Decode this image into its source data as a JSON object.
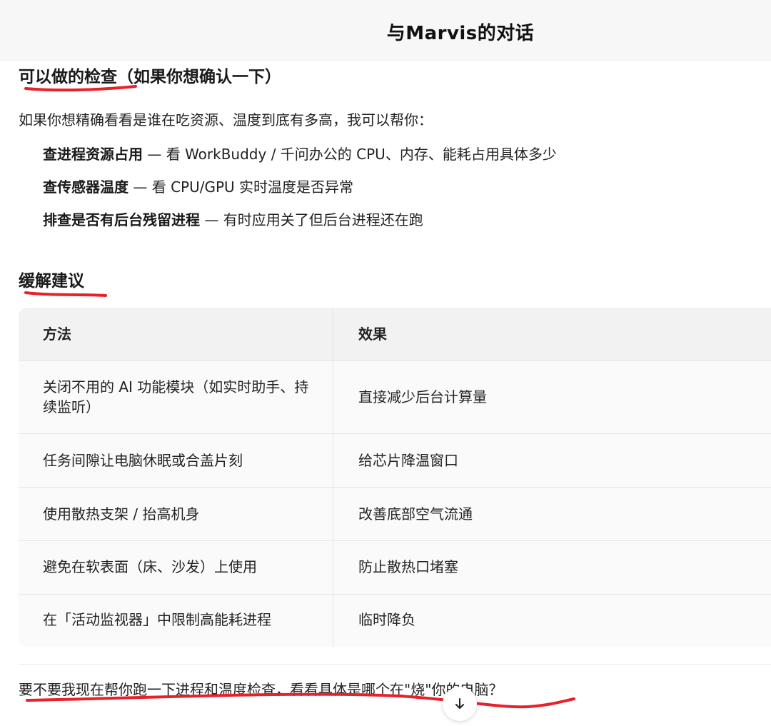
{
  "header": {
    "title": "与Marvis的对话"
  },
  "section_check": {
    "heading": "可以做的检查（如果你想确认一下）",
    "intro": "如果你想精确看看是谁在吃资源、温度到底有多高，我可以帮你：",
    "items": [
      {
        "bold": "查进程资源占用",
        "rest": " — 看 WorkBuddy / 千问办公的 CPU、内存、能耗占用具体多少"
      },
      {
        "bold": "查传感器温度",
        "rest": " — 看 CPU/GPU 实时温度是否异常"
      },
      {
        "bold": "排查是否有后台残留进程",
        "rest": " — 有时应用关了但后台进程还在跑"
      }
    ]
  },
  "section_advice": {
    "heading": "缓解建议",
    "table": {
      "headers": [
        "方法",
        "效果"
      ],
      "rows": [
        [
          "关闭不用的 AI 功能模块（如实时助手、持续监听）",
          "直接减少后台计算量"
        ],
        [
          "任务间隙让电脑休眠或合盖片刻",
          "给芯片降温窗口"
        ],
        [
          "使用散热支架 / 抬高机身",
          "改善底部空气流通"
        ],
        [
          "避免在软表面（床、沙发）上使用",
          "防止散热口堵塞"
        ],
        [
          "在「活动监视器」中限制高能耗进程",
          "临时降负"
        ]
      ]
    }
  },
  "question": "要不要我现在帮你跑一下进程和温度检查，看看具体是哪个在\"烧\"你的电脑？",
  "colors": {
    "annotation_red": "#e8202a",
    "table_header_bg": "#f2f2f2"
  },
  "icons": {
    "scroll_down": "arrow-down-icon"
  }
}
